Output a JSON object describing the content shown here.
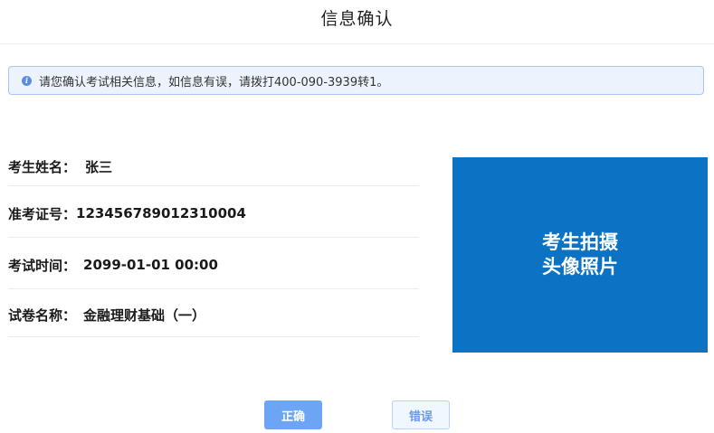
{
  "header": {
    "title": "信息确认"
  },
  "notice": {
    "icon": "info-icon",
    "text": "请您确认考试相关信息，如信息有误，请拨打400-090-3939转1。"
  },
  "candidate": {
    "name_label": "考生姓名：",
    "name_value": "张三",
    "ticket_label": "准考证号：",
    "ticket_value": "123456789012310004",
    "time_label": "考试时间：",
    "time_value": "2099-01-01 00:00",
    "paper_label": "试卷名称：",
    "paper_value": "金融理财基础（一）"
  },
  "photo": {
    "text": "考生拍摄\n头像照片",
    "background": "#0b72c4"
  },
  "actions": {
    "correct_label": "正确",
    "wrong_label": "错误"
  },
  "colors": {
    "accent": "#6ca5f3",
    "notice_bg": "#edf3fc",
    "notice_border": "#a9c6ee"
  }
}
